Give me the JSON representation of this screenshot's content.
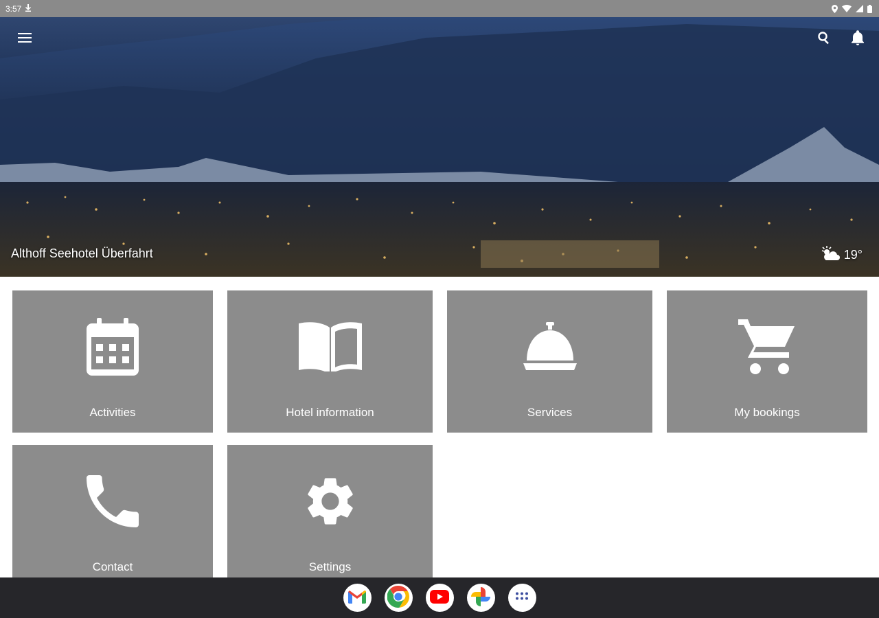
{
  "status_bar": {
    "time": "3:57"
  },
  "hero": {
    "title": "Althoff Seehotel Überfahrt",
    "weather_temp": "19°",
    "weather_icon": "partly-cloudy-icon"
  },
  "tiles": [
    {
      "label": "Activities",
      "icon": "calendar-icon"
    },
    {
      "label": "Hotel information",
      "icon": "book-icon"
    },
    {
      "label": "Services",
      "icon": "service-bell-icon"
    },
    {
      "label": "My bookings",
      "icon": "cart-icon"
    },
    {
      "label": "Contact",
      "icon": "phone-icon"
    },
    {
      "label": "Settings",
      "icon": "gear-icon"
    }
  ],
  "taskbar": {
    "apps": [
      "gmail-icon",
      "chrome-icon",
      "youtube-icon",
      "photos-icon",
      "app-drawer-icon"
    ]
  },
  "colors": {
    "tile_bg": "#8c8c8c",
    "status_bar_bg": "#8a8a8a",
    "taskbar_bg": "#26262a"
  }
}
